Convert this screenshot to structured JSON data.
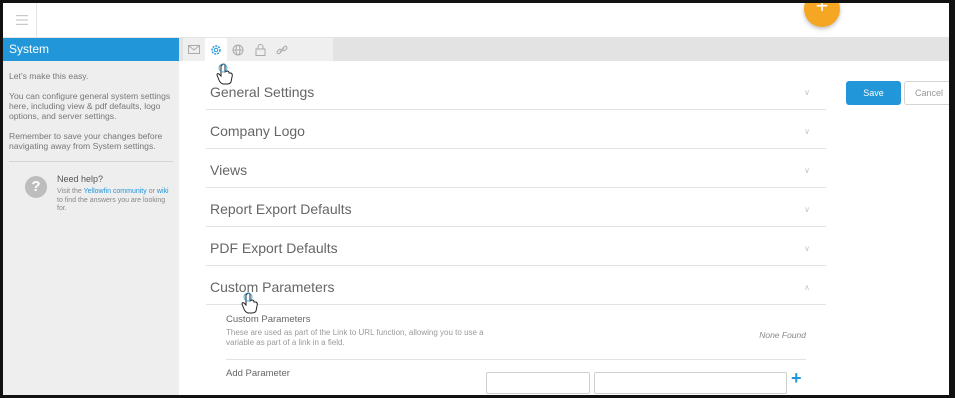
{
  "sidebar": {
    "title": "System",
    "intro": "Let's make this easy.",
    "description": "You can configure general system settings here, including view & pdf defaults, logo options, and server settings.",
    "reminder": "Remember to save your changes before navigating away from System settings.",
    "help": {
      "title": "Need help?",
      "text_before": "Visit the ",
      "community_link": "Yellowfin community",
      "text_middle": " or ",
      "wiki_link": "wiki",
      "text_after": " to find the answers you are looking for."
    }
  },
  "tabs": [
    {
      "icon": "envelope-icon",
      "active": false
    },
    {
      "icon": "gear-icon",
      "active": true
    },
    {
      "icon": "globe-icon",
      "active": false
    },
    {
      "icon": "lock-icon",
      "active": false
    },
    {
      "icon": "link-icon",
      "active": false
    }
  ],
  "sections": [
    {
      "title": "General Settings",
      "expanded": false
    },
    {
      "title": "Company Logo",
      "expanded": false
    },
    {
      "title": "Views",
      "expanded": false
    },
    {
      "title": "Report Export Defaults",
      "expanded": false
    },
    {
      "title": "PDF Export Defaults",
      "expanded": false
    },
    {
      "title": "Custom Parameters",
      "expanded": true
    }
  ],
  "custom_parameters": {
    "label": "Custom Parameters",
    "description": "These are used as part of the Link to URL function, allowing you to use a variable as part of a link in a field.",
    "status": "None Found",
    "add_label": "Add Parameter",
    "add_icon": "plus-icon"
  },
  "actions": {
    "save_label": "Save",
    "cancel_label": "Cancel"
  },
  "colors": {
    "accent": "#2196d9",
    "fab": "#f5a623"
  }
}
